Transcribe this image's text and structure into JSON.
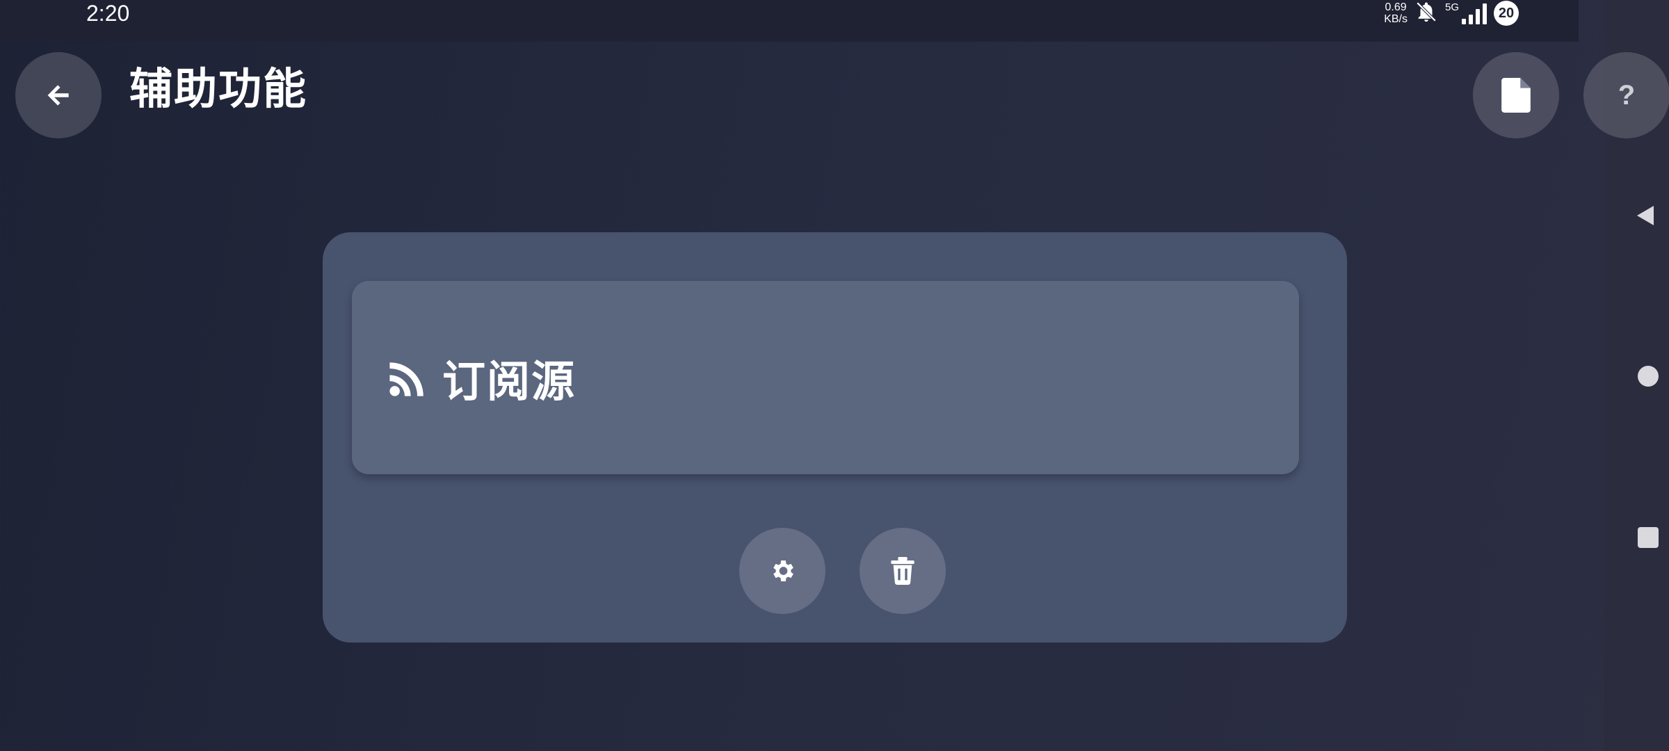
{
  "status_bar": {
    "time": "2:20",
    "net_speed_value": "0.69",
    "net_speed_unit": "KB/s",
    "network_type": "5G",
    "battery": "20"
  },
  "header": {
    "title": "辅助功能"
  },
  "rule": {
    "label": "订阅源",
    "icon": "rss-icon"
  },
  "actions": {
    "settings_icon": "gear-icon",
    "delete_icon": "trash-icon"
  },
  "colors": {
    "card": "#48536e",
    "tile": "#5b667f",
    "background": "#262b40"
  }
}
